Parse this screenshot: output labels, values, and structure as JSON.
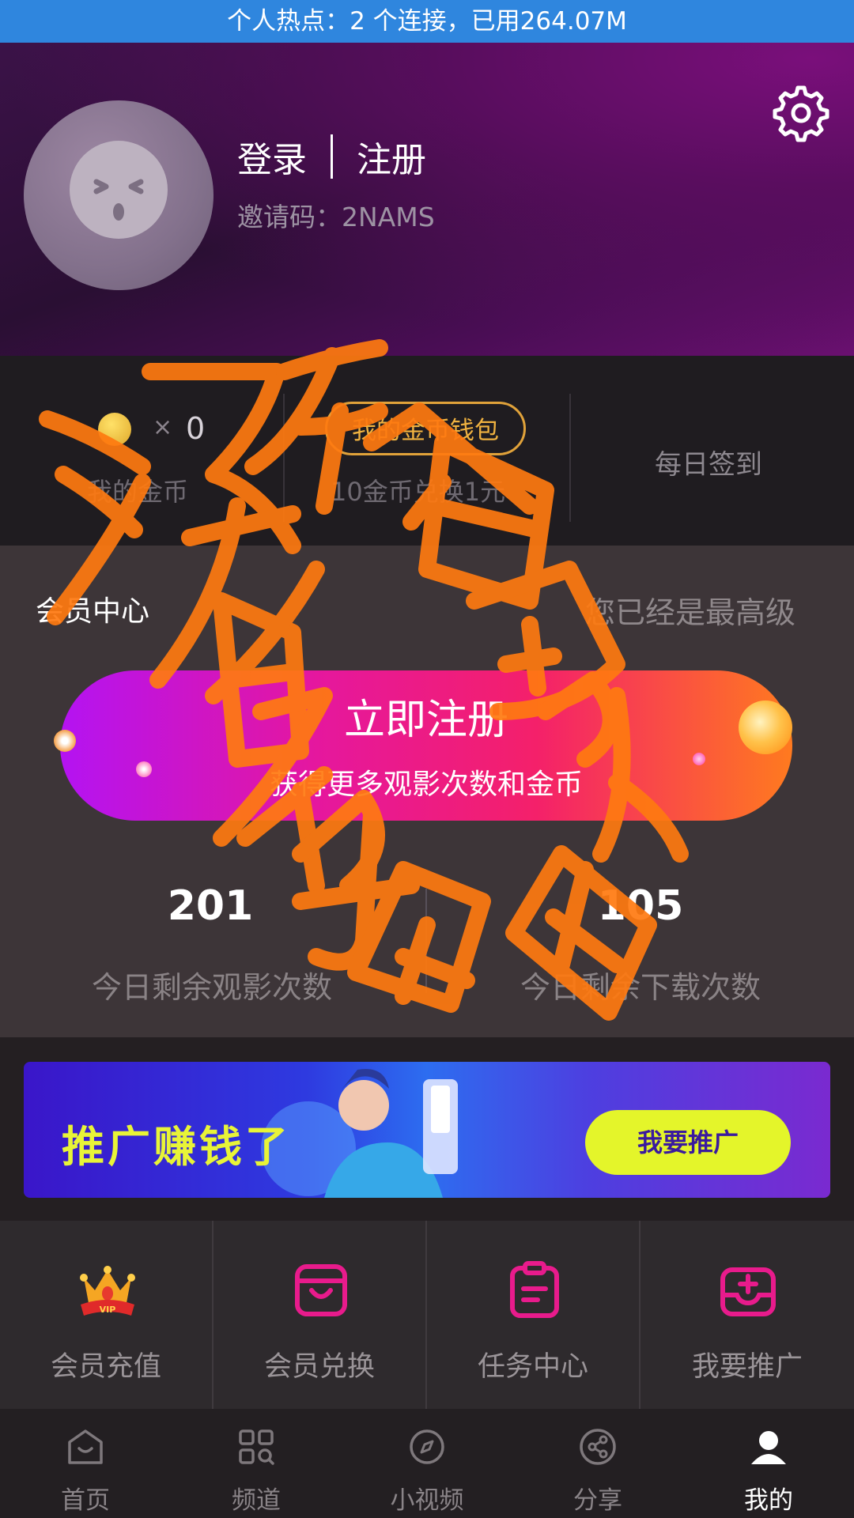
{
  "status_bar": {
    "text": "个人热点：2 个连接，已用264.07M"
  },
  "profile": {
    "login_label": "登录",
    "register_label": "注册",
    "invite_code": "邀请码：2NAMS",
    "settings_icon": "gear-icon"
  },
  "coins": {
    "multiplier": "×",
    "count": "0",
    "label": "我的金币",
    "wallet_button": "我的金币钱包",
    "exchange_rate": "10金币兑换1元",
    "daily_checkin": "每日签到"
  },
  "member": {
    "title": "会员中心",
    "level_status": "您已经是最高级",
    "register_title": "立即注册",
    "register_subtitle": "获得更多观影次数和金币",
    "views_left": "201",
    "views_left_label": "今日剩余观影次数",
    "downloads_left": "105",
    "downloads_left_label": "今日剩余下载次数"
  },
  "promo": {
    "banner_text": "推广赚钱了",
    "button_label": "我要推广"
  },
  "grid": {
    "items": [
      {
        "label": "会员充值",
        "icon": "vip-crown-icon"
      },
      {
        "label": "会员兑换",
        "icon": "exchange-bag-icon"
      },
      {
        "label": "任务中心",
        "icon": "clipboard-icon"
      },
      {
        "label": "我要推广",
        "icon": "promote-tray-icon"
      }
    ]
  },
  "nav": {
    "items": [
      {
        "label": "首页",
        "icon": "home-icon"
      },
      {
        "label": "频道",
        "icon": "channels-grid-icon"
      },
      {
        "label": "小视频",
        "icon": "compass-icon"
      },
      {
        "label": "分享",
        "icon": "share-icon"
      },
      {
        "label": "我的",
        "icon": "user-icon",
        "active": true
      }
    ]
  },
  "watermark": {
    "text": "没有名字团队 佐猫团队"
  },
  "colors": {
    "accent_pink": "#e81b8c",
    "gold": "#e0a23a",
    "status_bar": "#2f86de",
    "banner_button": "#e4f52a"
  }
}
